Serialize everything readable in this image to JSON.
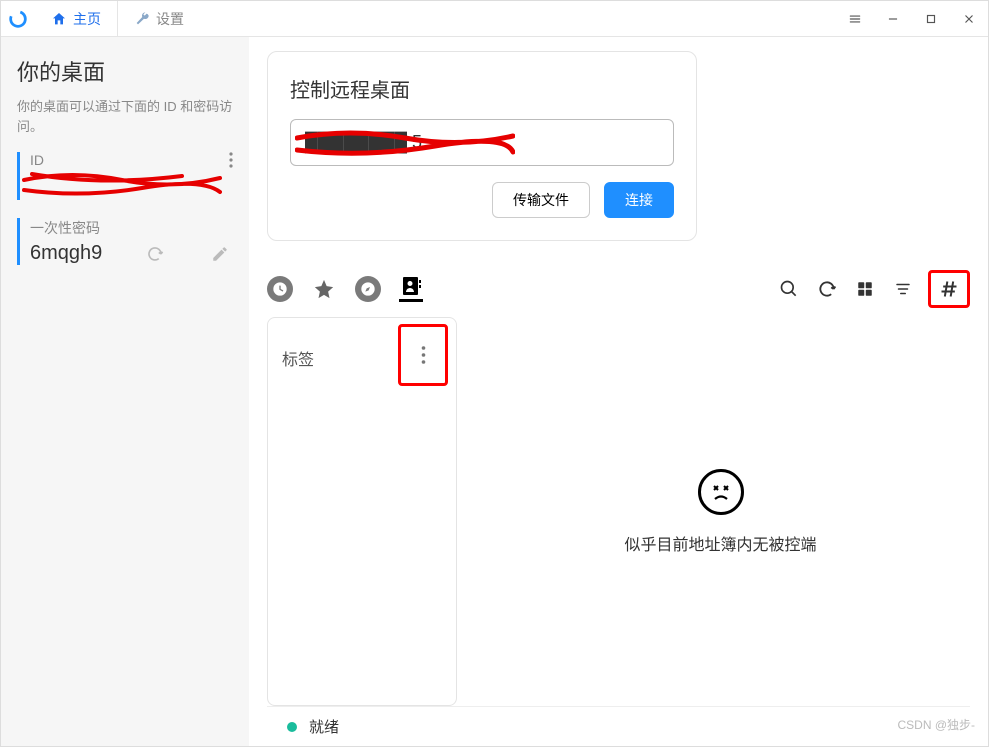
{
  "titlebar": {
    "tabs": {
      "home": "主页",
      "settings": "设置"
    }
  },
  "sidebar": {
    "title": "你的桌面",
    "subtitle": "你的桌面可以通过下面的 ID 和密码访问。",
    "id_label": "ID",
    "id_value_redacted": "████████",
    "otp_label": "一次性密码",
    "otp_value": "6mqgh9"
  },
  "remote": {
    "title": "控制远程桌面",
    "input_value_redacted": "████████ 5",
    "transfer_btn": "传输文件",
    "connect_btn": "连接"
  },
  "tags": {
    "label": "标签"
  },
  "empty": {
    "text": "似乎目前地址簿内无被控端"
  },
  "status": {
    "text": "就绪"
  },
  "watermark": "CSDN @独步-"
}
